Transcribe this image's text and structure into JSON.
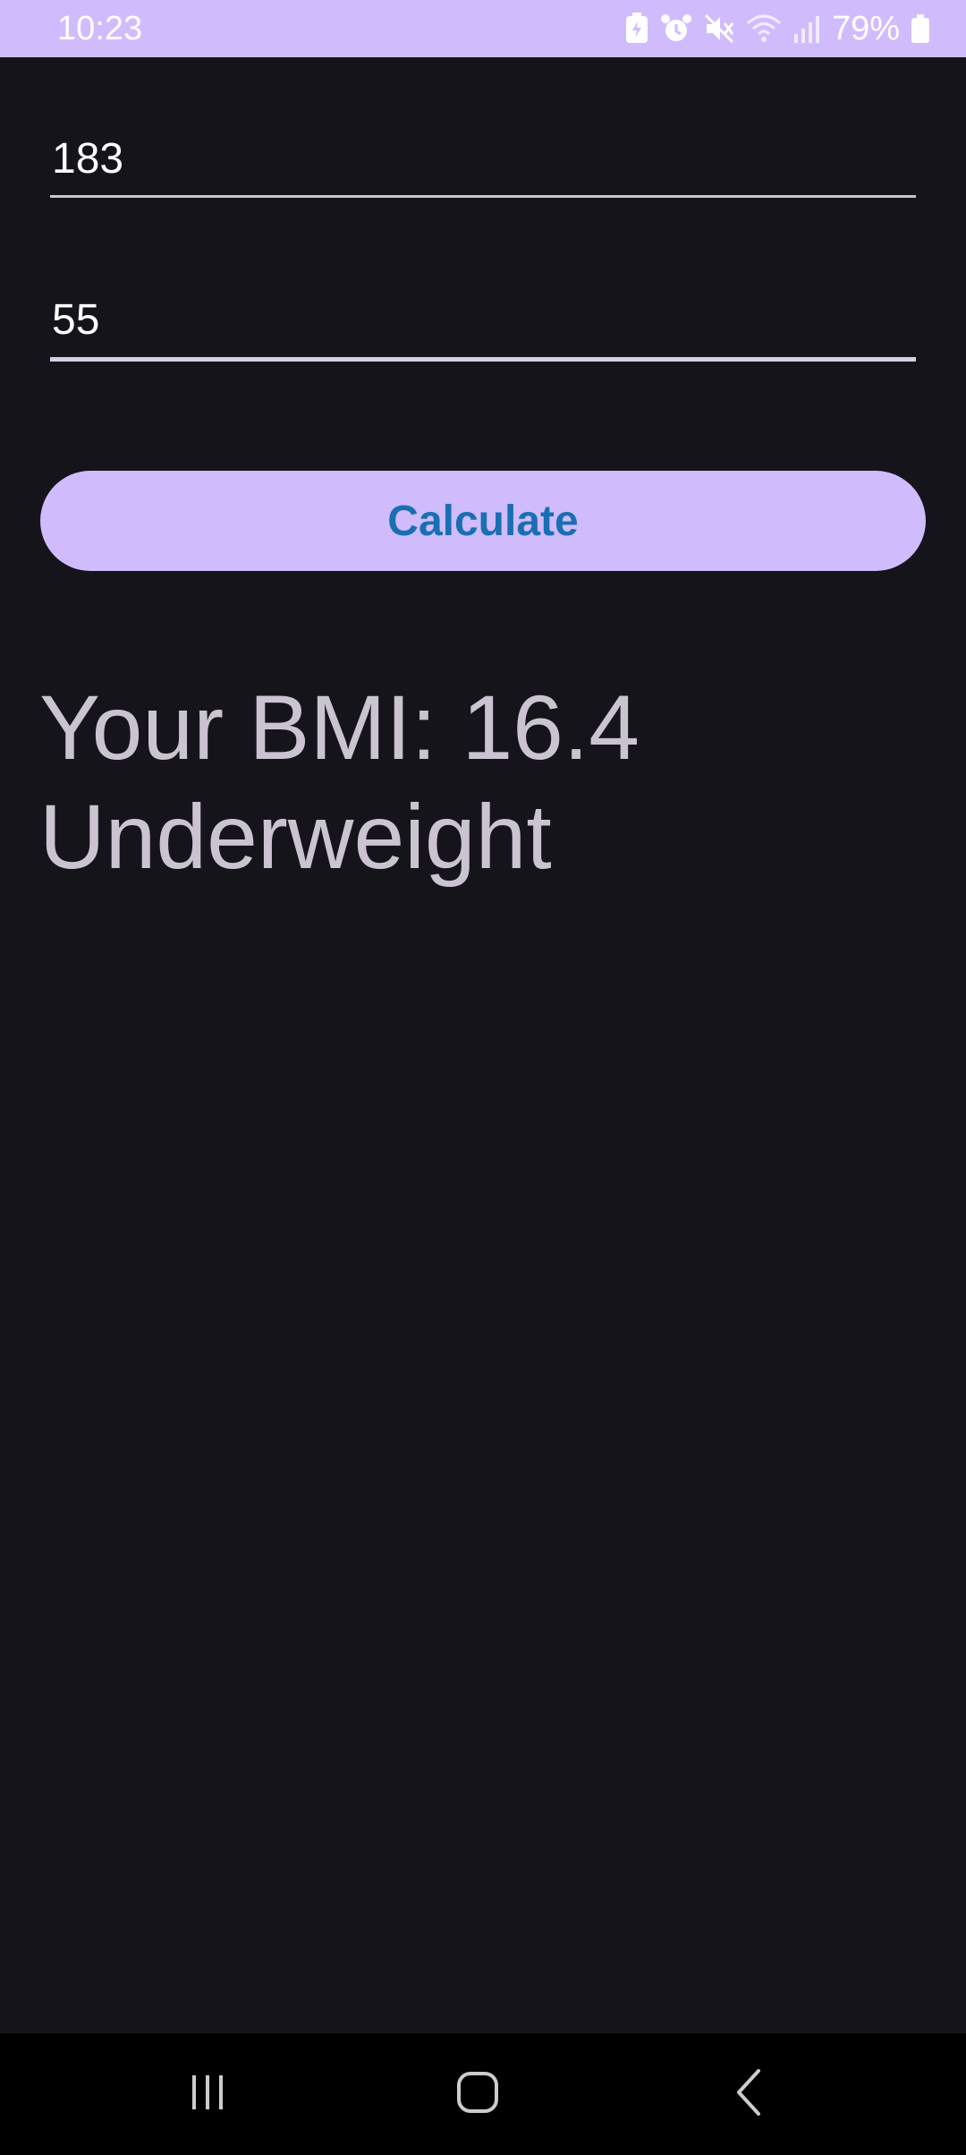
{
  "status_bar": {
    "time": "10:23",
    "battery_percent": "79%",
    "icons": [
      "battery-saver-icon",
      "alarm-icon",
      "mute-icon",
      "wifi-icon",
      "signal-icon",
      "battery-icon"
    ],
    "background": "#d0bcfd"
  },
  "form": {
    "height_value": "183",
    "weight_value": "55",
    "calculate_label": "Calculate"
  },
  "result": {
    "bmi_text": "Your BMI: 16.4",
    "category": "Underweight"
  },
  "nav_bar": {
    "icons": [
      "recent-apps-icon",
      "home-icon",
      "back-icon"
    ]
  },
  "colors": {
    "background": "#16141b",
    "accent": "#d0bcfd",
    "button_text": "#1a6fb3",
    "result_text": "#cac4d0"
  }
}
